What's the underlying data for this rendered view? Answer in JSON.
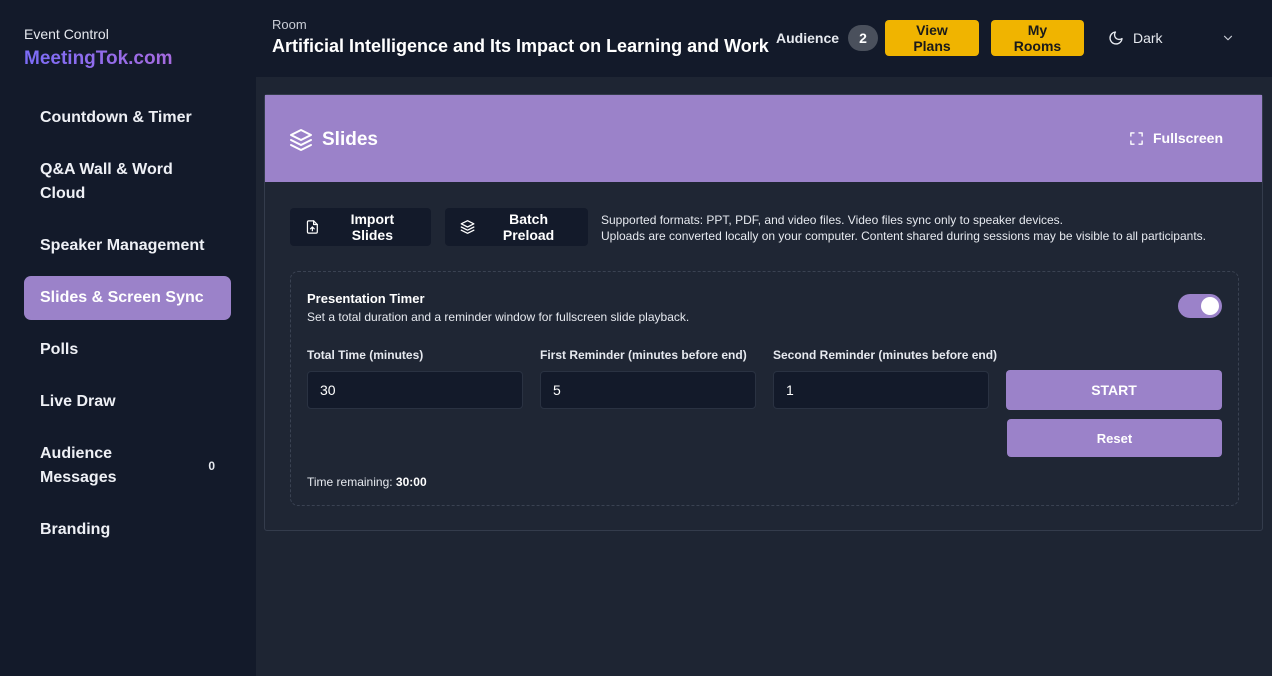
{
  "sidebar": {
    "caption": "Event Control",
    "brand": "MeetingTok.com",
    "items": [
      {
        "label": "Countdown & Timer"
      },
      {
        "label": "Q&A Wall & Word Cloud"
      },
      {
        "label": "Speaker Management"
      },
      {
        "label": "Slides & Screen Sync",
        "active": true
      },
      {
        "label": "Polls"
      },
      {
        "label": "Live Draw"
      },
      {
        "label": "Audience Messages",
        "badge": "0"
      },
      {
        "label": "Branding"
      }
    ]
  },
  "header": {
    "room_label": "Room",
    "room_title": "Artificial Intelligence and Its Impact on Learning and Work",
    "audience_label": "Audience",
    "audience_count": "2",
    "view_plans": "View Plans",
    "my_rooms": "My Rooms",
    "theme": "Dark"
  },
  "slides": {
    "title": "Slides",
    "fullscreen": "Fullscreen",
    "import": "Import Slides",
    "batch": "Batch Preload",
    "formats_line1": "Supported formats: PPT, PDF, and video files. Video files sync only to speaker devices.",
    "formats_line2": "Uploads are converted locally on your computer. Content shared during sessions may be visible to all participants."
  },
  "timer": {
    "title": "Presentation Timer",
    "desc": "Set a total duration and a reminder window for fullscreen slide playback.",
    "enabled": true,
    "total_label": "Total Time (minutes)",
    "total_value": "30",
    "first_label": "First Reminder (minutes before end)",
    "first_value": "5",
    "second_label": "Second Reminder (minutes before end)",
    "second_value": "1",
    "start": "START",
    "reset": "Reset",
    "remaining_label": "Time remaining: ",
    "remaining_value": "30:00"
  },
  "colors": {
    "accent": "#9b82c9",
    "yellow": "#f0b400",
    "sidebar_bg": "#131a2a",
    "main_bg": "#1e2533"
  },
  "icons": {
    "slides": "layers-icon",
    "fullscreen": "expand-corners-icon",
    "import": "file-upload-icon",
    "batch": "layers-icon",
    "theme": "moon-icon",
    "dropdown": "chevron-down-icon"
  }
}
